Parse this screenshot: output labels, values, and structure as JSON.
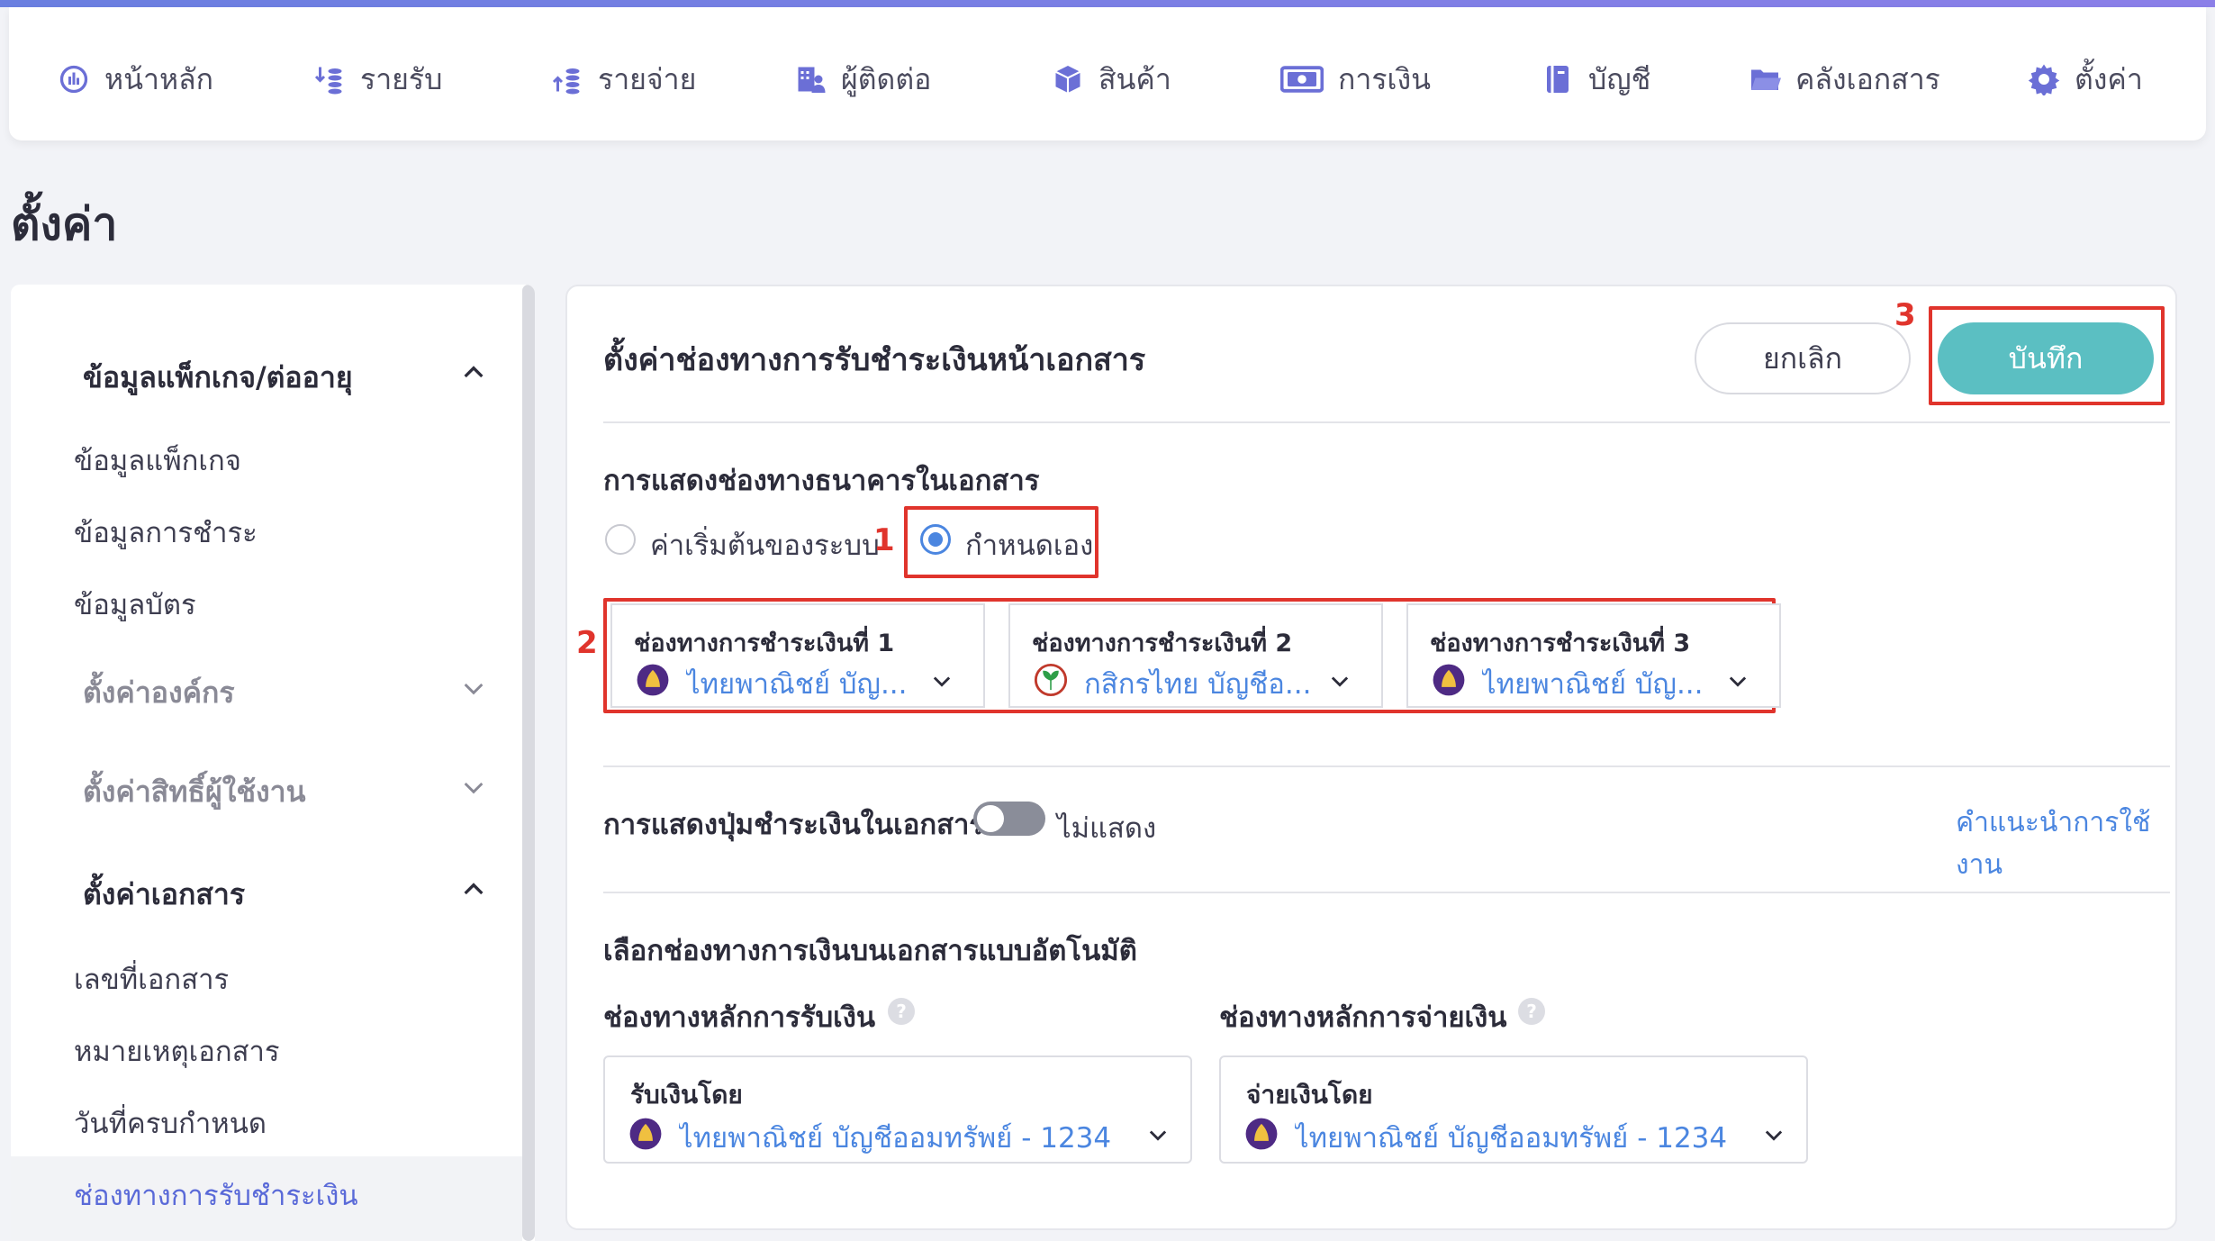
{
  "nav": {
    "items": [
      {
        "label": "หน้าหลัก",
        "icon": "dashboard-icon"
      },
      {
        "label": "รายรับ",
        "icon": "income-icon"
      },
      {
        "label": "รายจ่าย",
        "icon": "expense-icon"
      },
      {
        "label": "ผู้ติดต่อ",
        "icon": "contacts-icon"
      },
      {
        "label": "สินค้า",
        "icon": "box-icon"
      },
      {
        "label": "การเงิน",
        "icon": "money-icon"
      },
      {
        "label": "บัญชี",
        "icon": "ledger-icon"
      },
      {
        "label": "คลังเอกสาร",
        "icon": "folder-icon"
      },
      {
        "label": "ตั้งค่า",
        "icon": "gear-icon"
      }
    ]
  },
  "page": {
    "title": "ตั้งค่า"
  },
  "sidebar": {
    "group_package": "ข้อมูลแพ็กเกจ/ต่ออายุ",
    "package_items": [
      "ข้อมูลแพ็กเกจ",
      "ข้อมูลการชำระ",
      "ข้อมูลบัตร"
    ],
    "group_org": "ตั้งค่าองค์กร",
    "group_permissions": "ตั้งค่าสิทธิ์ผู้ใช้งาน",
    "group_documents": "ตั้งค่าเอกสาร",
    "document_items": [
      "เลขที่เอกสาร",
      "หมายเหตุเอกสาร",
      "วันที่ครบกำหนด"
    ],
    "active_item": "ช่องทางการรับชำระเงิน"
  },
  "panel": {
    "title": "ตั้งค่าช่องทางการรับชำระเงินหน้าเอกสาร",
    "cancel_label": "ยกเลิก",
    "save_label": "บันทึก",
    "bank_display_label": "การแสดงช่องทางธนาคารในเอกสาร",
    "radio_default": "ค่าเริ่มต้นของระบบ",
    "radio_custom": "กำหนดเอง",
    "channels": [
      {
        "title": "ช่องทางการชำระเงินที่ 1",
        "value": "ไทยพาณิชย์ บัญ...",
        "bank_icon": "scb-bank-icon"
      },
      {
        "title": "ช่องทางการชำระเงินที่ 2",
        "value": "กสิกรไทย บัญชีอ...",
        "bank_icon": "kbank-bank-icon"
      },
      {
        "title": "ช่องทางการชำระเงินที่ 3",
        "value": "ไทยพาณิชย์ บัญ...",
        "bank_icon": "scb-bank-icon"
      }
    ],
    "pay_button_label": "การแสดงปุ่มชำระเงินในเอกสาร",
    "pay_button_state": "ไม่แสดง",
    "guide_link": "คำแนะนำการใช้งาน",
    "auto_select_label": "เลือกช่องทางการเงินบนเอกสารแบบอัตโนมัติ",
    "receive_main_label": "ช่องทางหลักการรับเงิน",
    "pay_main_label": "ช่องทางหลักการจ่ายเงิน",
    "receive_select_label": "รับเงินโดย",
    "receive_select_value": "ไทยพาณิชย์ บัญชีออมทรัพย์ - 1234...",
    "pay_select_label": "จ่ายเงินโดย",
    "pay_select_value": "ไทยพาณิชย์ บัญชีออมทรัพย์ - 1234...",
    "help_glyph": "?"
  },
  "annotations": {
    "step1": "1",
    "step2": "2",
    "step3": "3"
  },
  "colors": {
    "accent": "#5bbfc2",
    "link": "#4b86e0",
    "highlight": "#e0342c",
    "nav_icon": "#6b6fd6"
  }
}
